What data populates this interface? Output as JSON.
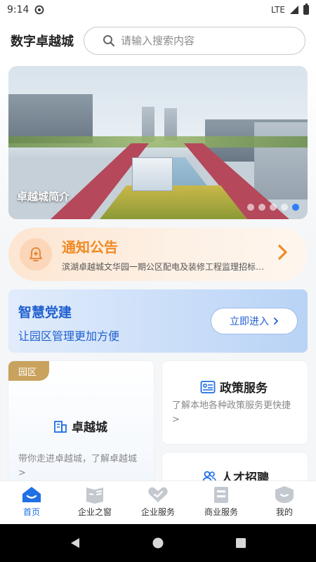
{
  "status_bar": {
    "time": "9:14",
    "network": "LTE"
  },
  "header": {
    "title": "数字卓越城",
    "search_placeholder": "请输入搜索内容"
  },
  "banner": {
    "caption": "卓越城简介",
    "slide_count": 5,
    "active_slide": 5
  },
  "notice": {
    "title": "通知公告",
    "text": "滨湖卓越城文华园一期公区配电及装修工程监理招标公告"
  },
  "party": {
    "title": "智慧党建",
    "subtitle": "让园区管理更加方便",
    "button_label": "立即进入"
  },
  "park_card": {
    "tag": "园区",
    "title": "卓越城",
    "desc": "带你走进卓越城，了解卓越城 >"
  },
  "policy_card": {
    "title": "政策服务",
    "desc": "了解本地各种政策服务更快捷 >"
  },
  "talent_card": {
    "title": "人才招聘"
  },
  "tabbar": {
    "items": [
      {
        "label": "首页",
        "icon": "home-icon"
      },
      {
        "label": "企业之窗",
        "icon": "enterprise-window-icon"
      },
      {
        "label": "企业服务",
        "icon": "enterprise-service-icon"
      },
      {
        "label": "商业服务",
        "icon": "business-service-icon"
      },
      {
        "label": "我的",
        "icon": "profile-icon"
      }
    ],
    "active_index": 0
  },
  "colors": {
    "accent": "#1f6fe5",
    "notice": "#f08a24",
    "tab_inactive_icon": "#c4c8cf"
  }
}
